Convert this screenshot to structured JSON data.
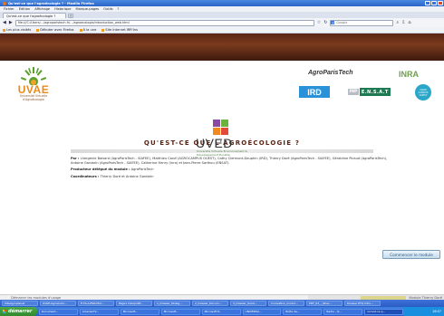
{
  "window": {
    "title": "Qu'est-ce que l'agroécologie ? - Mozilla Firefox"
  },
  "menu": [
    "Fichier",
    "Édition",
    "Affichage",
    "Historique",
    "Marque-pages",
    "Outils",
    "?"
  ],
  "tab": {
    "label": "Qu'est-ce que l'agroécologie ?",
    "new_tab": "+"
  },
  "nav": {
    "url": "file:///C:/Users/.../agroparistech.fr/.../agroecologie/introduction_web.html",
    "search_placeholder": "Google"
  },
  "bookmarks": [
    "Les plus visités",
    "Débuter avec Firefox",
    "À la une",
    "Site Internet IRR'Ins"
  ],
  "logos": {
    "uvae": "UVAE",
    "uvae_sub": "Université Virtuelle d'Agroécologie",
    "agroparistech": "AgroParisTech",
    "inra": "INRA",
    "ird": "IRD",
    "inp": "INP",
    "ensat": "E.N.S.A.T",
    "agrocampus": "AGRO CAMPUS OUEST",
    "uved": "UVED",
    "uved_tag": "Université Virtuelle Environnement & Développement Durable"
  },
  "page": {
    "title": "QU'EST-CE QUE L'AGROÉCOLOGIE ?",
    "par_label": "Par :",
    "authors": "Lhergenie Boisard (AgroParisTech - SIAFEE), Matthieu Carof (AGROCAMPUS OUEST), Cathy Clermont-Dauphin (IRD), Thierry Doré (AgroParisTech - SIAFEE), Géraldine Picaud (AgroParisTech), Antoine Gardarin (AgroParisTech - SIAFEE), Catherine Henry (Inra) et Jean-Pierre Sarthou (ENSAT).",
    "producer_label": "Producteur délégué du module :",
    "producer": "AgroParisTech",
    "coordinators_label": "Coordinateurs :",
    "coordinators": "Thierry Doré et Antoine Gardarin",
    "start_button": "Commencer le module"
  },
  "status": {
    "left": "Démarrer les modules d'usage",
    "right": "Module Thierry Doré"
  },
  "taskbar": {
    "start": "démarrer",
    "top_items": [
      "SiteAgroplanet",
      "UVAE-Agroécolo...",
      "E.TA-A-ESR-Micr...",
      "Page1 Interprétt...",
      "1_Dossier_Pedag...",
      "2_Dossier_Docum...",
      "3_Dossier_Solut...",
      "Innovation_modul...",
      "PDF_03_-_Nive...",
      "Dossier ETQ Intro..."
    ],
    "items": [
      "Document...",
      "AmenentV...",
      "Microsoft...",
      "Microsoft...",
      "Microsoft P...",
      "UNIVERSA...",
      "Boîte de...",
      "Radio - Q...",
      "Pm Zuhand...",
      "Qu'est-ce q..."
    ],
    "clock": "16:07"
  }
}
